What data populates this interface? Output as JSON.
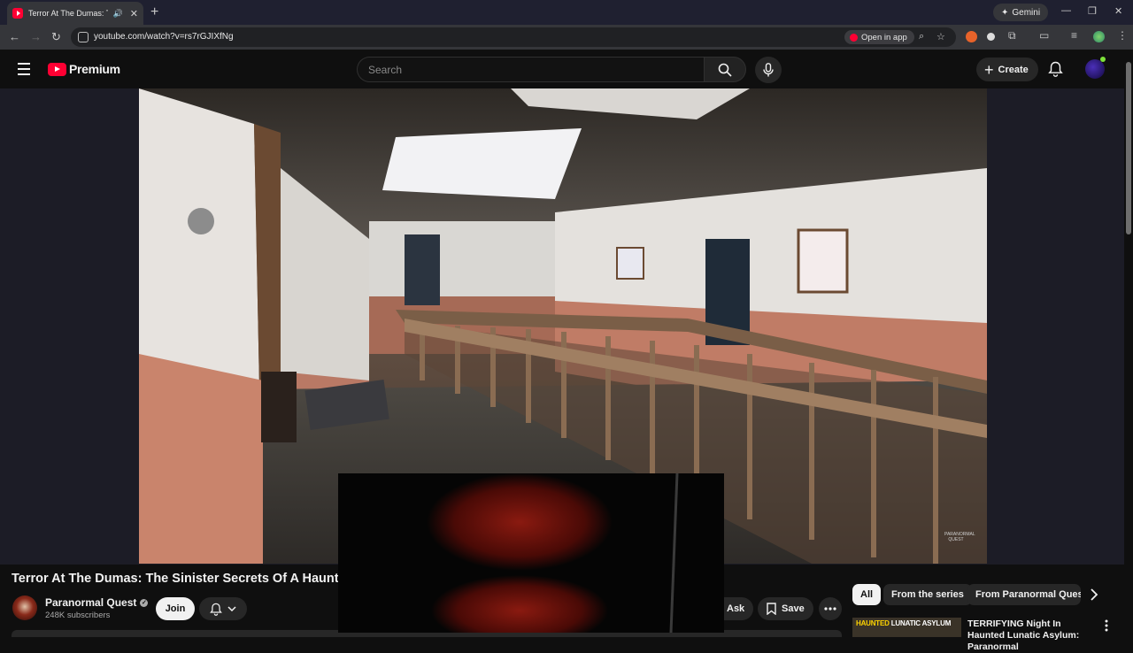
{
  "browser": {
    "tab_title": "Terror At The Dumas: The S",
    "tab_audio": "🔊",
    "tab_close": "✕",
    "new_tab": "+",
    "gemini_label": "Gemini",
    "url": "youtube.com/watch?v=rs7rGJIXfNg",
    "open_in_app": "Open in app",
    "minimize": "—",
    "restore": "❐",
    "close": "✕"
  },
  "youtube": {
    "logo_text": "Premium",
    "search_placeholder": "Search",
    "create_label": "Create",
    "brand_red": "#ff0033"
  },
  "video": {
    "watermark": "PARANORMAL QUEST",
    "title": "Terror At The Dumas: The Sinister Secrets Of A Haunted",
    "channel": "Paranormal Quest",
    "verified_glyph": "✓",
    "subscribers": "248K subscribers",
    "join_label": "Join",
    "ask_label": "Ask",
    "save_label": "Save"
  },
  "sidebar": {
    "chips": [
      {
        "label": "All"
      },
      {
        "label": "From the series"
      },
      {
        "label": "From Paranormal Quest"
      }
    ],
    "recommendation": {
      "thumb_text_1": "HAUNTED",
      "thumb_text_2": "LUNATIC ASYLUM",
      "title": "TERRIFYING Night In Haunted Lunatic Asylum: Paranormal"
    }
  }
}
